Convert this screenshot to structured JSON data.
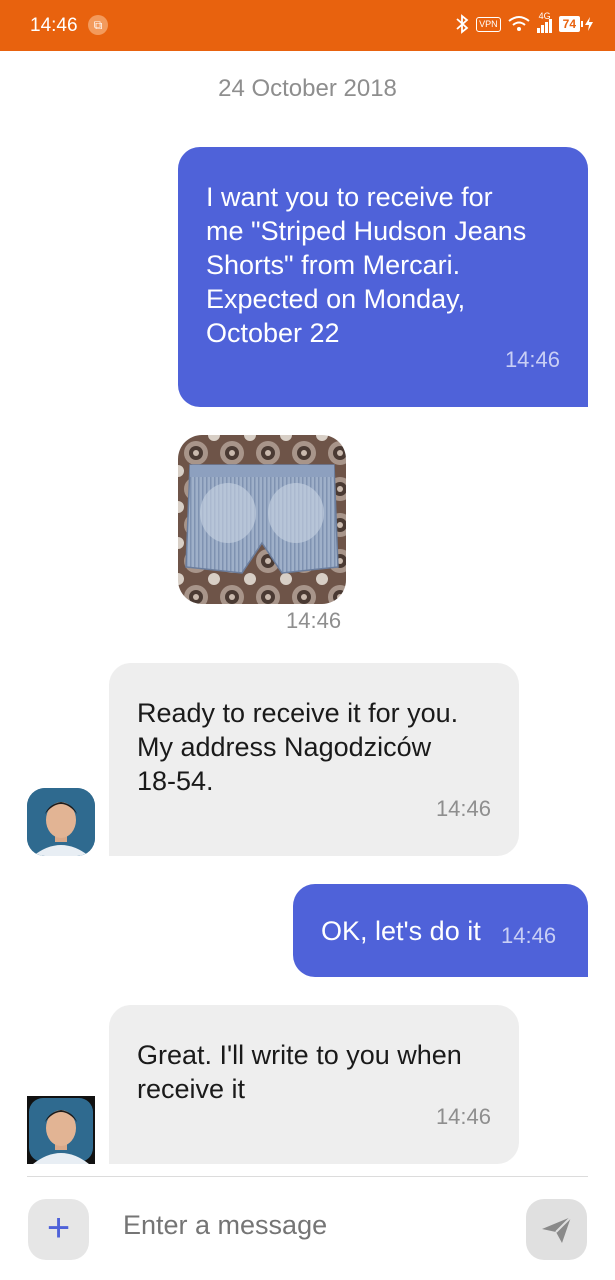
{
  "status_bar": {
    "time": "14:46",
    "notification_icon": "screenshot-icon",
    "vpn": "VPN",
    "network": "4G",
    "battery": "74"
  },
  "chat": {
    "date": "24 October 2018",
    "messages": [
      {
        "side": "out",
        "text": "I want you to receive for me \"Striped Hudson Jeans Shorts\" from Mercari. Expected on Monday, October 22",
        "lines": [
          "I want you to receive for",
          "me \"Striped Hudson Jeans",
          "Shorts\" from Mercari.",
          "Expected on Monday,",
          "October 22"
        ],
        "time": "14:46"
      },
      {
        "side": "out",
        "type": "image",
        "subject": "jeans-shorts-photo",
        "time": "14:46"
      },
      {
        "side": "in",
        "lines": [
          "Ready to receive it for you.",
          "My address Nagodziców",
          "18-54."
        ],
        "time": "14:46"
      },
      {
        "side": "out",
        "lines": [
          "OK, let's do it"
        ],
        "time": "14:46"
      },
      {
        "side": "in",
        "lines": [
          "Great. I'll write to you when",
          "receive it"
        ],
        "time": "14:46"
      }
    ]
  },
  "composer": {
    "placeholder": "Enter a message",
    "add_icon": "plus-icon",
    "send_icon": "send-icon"
  },
  "colors": {
    "status_bar": "#e8620e",
    "outgoing_bubble": "#4f62d9",
    "incoming_bubble": "#eeeeee"
  }
}
